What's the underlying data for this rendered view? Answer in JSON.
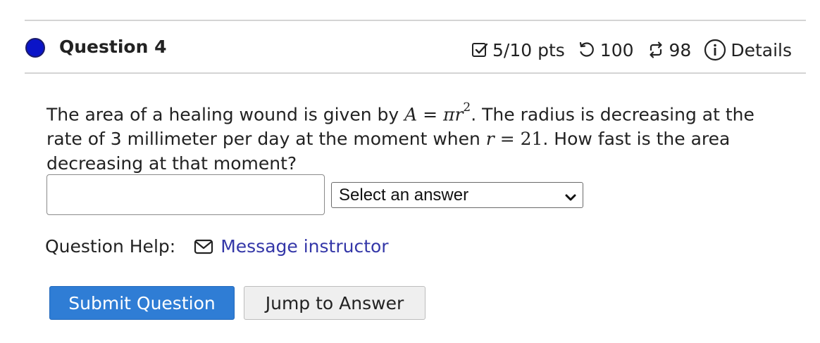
{
  "question": {
    "title": "Question 4",
    "status_color": "#0a14c8",
    "points": "5/10 pts",
    "retries": "100",
    "attempts": "98",
    "details_label": "Details",
    "text": {
      "p1": "The area of a healing wound is given by ",
      "eq1_lhs": "A",
      "eq1_eq": " = ",
      "eq1_rhs": "πr",
      "eq1_exp": "2",
      "p2": ". The radius is decreasing at the rate of 3 millimeter per day at the moment when ",
      "eq2_var": "r",
      "eq2_eq": " = ",
      "eq2_val": "21",
      "p3": ". How fast is the area decreasing at that moment?"
    }
  },
  "answer": {
    "input_value": "",
    "select_value": "Select an answer"
  },
  "help": {
    "label": "Question Help:",
    "message_link": "Message instructor"
  },
  "buttons": {
    "submit": "Submit Question",
    "jump": "Jump to Answer"
  },
  "icons": {
    "points": "checkbox-icon",
    "retries": "retry-icon",
    "attempts": "attempts-icon",
    "details": "info-icon",
    "message": "envelope-icon",
    "select": "chevron-down-icon"
  },
  "colors": {
    "accent": "#2f7dd5",
    "link": "#3437a8"
  }
}
